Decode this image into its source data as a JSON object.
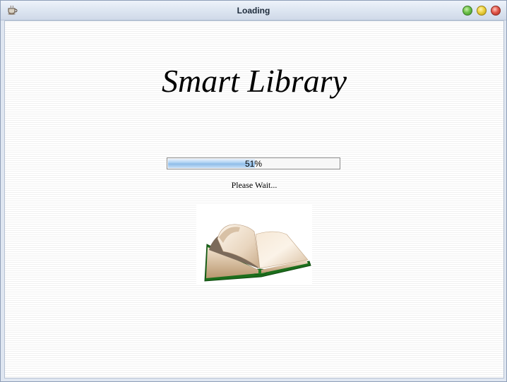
{
  "window": {
    "title": "Loading",
    "app_icon": "coffee-cup-icon",
    "controls": [
      "maximize",
      "minimize",
      "close"
    ]
  },
  "splash": {
    "app_title": "Smart Library",
    "status": "Please Wait...",
    "image_icon": "open-book-icon"
  },
  "progress": {
    "value": 51,
    "label": "51%"
  },
  "colors": {
    "progress_fill": "#8fbde9",
    "book_cover": "#1f7a1f"
  }
}
